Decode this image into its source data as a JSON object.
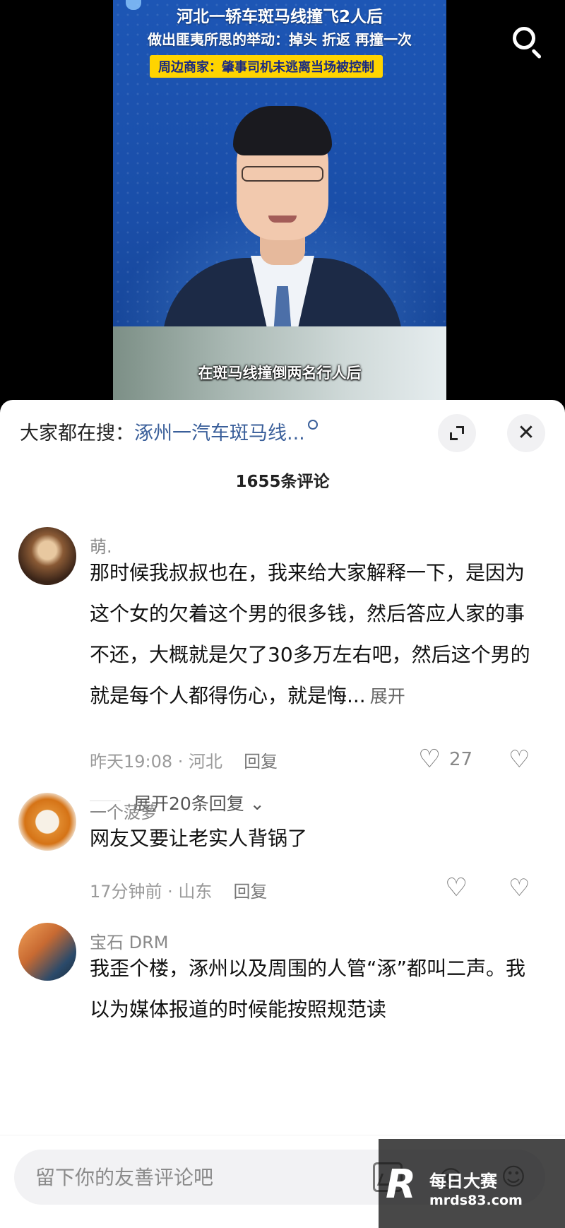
{
  "video": {
    "headline_line1": "河北一轿车斑马线撞飞2人后",
    "headline_line2": "做出匪夷所思的举动：掉头 折返 再撞一次",
    "headline_line3": "周边商家：肇事司机未逃离当场被控制",
    "subtitle": "在斑马线撞倒两名行人后",
    "search_icon": "search-icon"
  },
  "sheet": {
    "search_hint_prefix": "大家都在搜：",
    "search_hint_keyword": "涿州一汽车斑马线...",
    "comment_count": "1655条评论",
    "expand_icon": "expand-icon",
    "close_icon": "✕"
  },
  "comments": [
    {
      "user": "萌.",
      "text": "那时候我叔叔也在，我来给大家解释一下，是因为这个女的欠着这个男的很多钱，然后答应人家的事不还，大概就是欠了30多万左右吧，然后这个男的就是每个人都得伤心，就是悔...",
      "more": "展开",
      "time_location": "昨天19:08 · 河北",
      "reply": "回复",
      "likes": "27",
      "expand_replies": "展开20条回复 ⌄"
    },
    {
      "user": "一个菠萝",
      "text": "网友又要让老实人背锅了",
      "time_location": "17分钟前 · 山东",
      "reply": "回复",
      "likes": ""
    },
    {
      "user": "宝石 DRM",
      "text": "我歪个楼，涿州以及周围的人管“涿”都叫二声。我以为媒体报道的时候能按照规范读"
    }
  ],
  "input": {
    "placeholder": "留下你的友善评论吧",
    "icons": [
      "image-icon",
      "at-icon",
      "emoji-icon"
    ]
  },
  "watermark": {
    "logo": "R",
    "name": "每日大赛",
    "url": "mrds83.com"
  },
  "colors": {
    "keyword": "#3a5f9a",
    "video_bg": "#1d56b5",
    "headline_highlight": "#ffd400"
  }
}
